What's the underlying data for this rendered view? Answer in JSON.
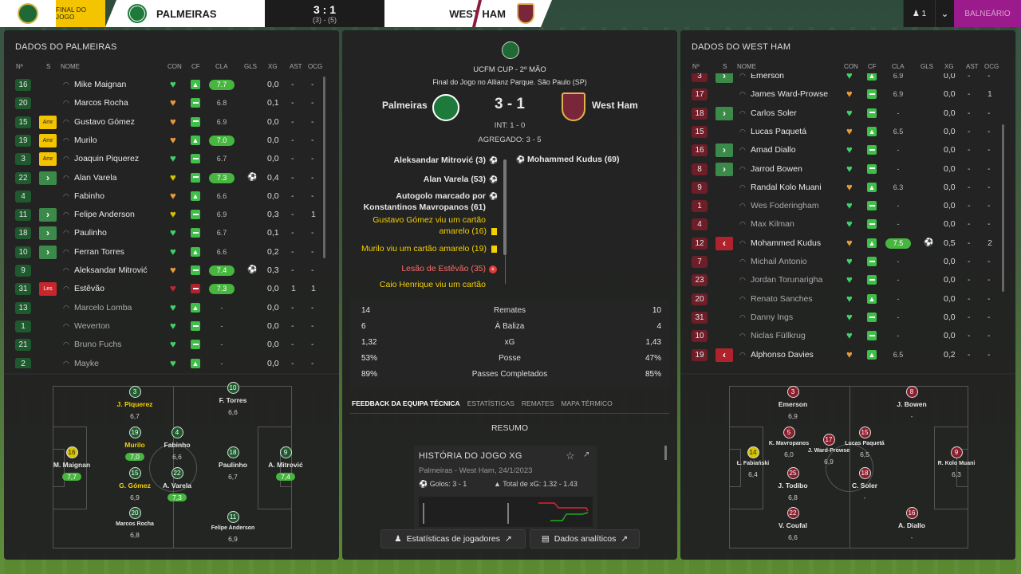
{
  "topbar": {
    "status": "FINAL DO JOGO",
    "home": "PALMEIRAS",
    "score": "3 : 1",
    "aggregate": "(3) - (5)",
    "away": "WEST HAM",
    "manager_count": "1",
    "balneario": "BALNEÁRIO"
  },
  "left": {
    "title": "DADOS DO PALMEIRAS",
    "headers": [
      "Nº",
      "S",
      "NOME",
      "CON",
      "CF",
      "CLA",
      "GLS",
      "XG",
      "AST",
      "OCG"
    ],
    "players": [
      {
        "n": "16",
        "s": "",
        "name": "Mike Maignan",
        "cla": "7.7",
        "xg": "0,0",
        "ast": "-",
        "ocg": "-",
        "hl": true
      },
      {
        "n": "20",
        "s": "",
        "name": "Marcos Rocha",
        "cla": "6.8",
        "xg": "0,1",
        "ast": "-",
        "ocg": "-"
      },
      {
        "n": "15",
        "s": "Amr",
        "name": "Gustavo Gómez",
        "cla": "6.9",
        "xg": "0,0",
        "ast": "-",
        "ocg": "-"
      },
      {
        "n": "19",
        "s": "Amr",
        "name": "Murilo",
        "cla": "7.0",
        "xg": "0,0",
        "ast": "-",
        "ocg": "-",
        "hl": true
      },
      {
        "n": "3",
        "s": "Amr",
        "name": "Joaquin Piquerez",
        "cla": "6.7",
        "xg": "0,0",
        "ast": "-",
        "ocg": "-"
      },
      {
        "n": "22",
        "s": "sub",
        "name": "Alan Varela",
        "cla": "7.3",
        "xg": "0,4",
        "ast": "-",
        "ocg": "-",
        "hl": true,
        "goal": true
      },
      {
        "n": "4",
        "s": "",
        "name": "Fabinho",
        "cla": "6.6",
        "xg": "0,0",
        "ast": "-",
        "ocg": "-"
      },
      {
        "n": "11",
        "s": "sub",
        "name": "Felipe Anderson",
        "cla": "6.9",
        "xg": "0,3",
        "ast": "-",
        "ocg": "1"
      },
      {
        "n": "18",
        "s": "sub",
        "name": "Paulinho",
        "cla": "6.7",
        "xg": "0,1",
        "ast": "-",
        "ocg": "-"
      },
      {
        "n": "10",
        "s": "sub",
        "name": "Ferran Torres",
        "cla": "6.6",
        "xg": "0,2",
        "ast": "-",
        "ocg": "-"
      },
      {
        "n": "9",
        "s": "",
        "name": "Aleksandar Mitrović",
        "cla": "7.4",
        "xg": "0,3",
        "ast": "-",
        "ocg": "-",
        "hl": true,
        "goal": true
      },
      {
        "n": "31",
        "s": "Les",
        "name": "Estêvão",
        "cla": "7.3",
        "xg": "0,0",
        "ast": "1",
        "ocg": "1",
        "hl": true,
        "red": true
      },
      {
        "n": "13",
        "s": "",
        "name": "Marcelo Lomba",
        "cla": "-",
        "xg": "0,0",
        "ast": "-",
        "ocg": "-",
        "dim": true
      },
      {
        "n": "1",
        "s": "",
        "name": "Weverton",
        "cla": "-",
        "xg": "0,0",
        "ast": "-",
        "ocg": "-",
        "dim": true
      },
      {
        "n": "21",
        "s": "",
        "name": "Bruno Fuchs",
        "cla": "-",
        "xg": "0,0",
        "ast": "-",
        "ocg": "-",
        "dim": true
      },
      {
        "n": "2",
        "s": "",
        "name": "Mayke",
        "cla": "-",
        "xg": "0,0",
        "ast": "-",
        "ocg": "-",
        "dim": true
      }
    ],
    "pitch": [
      {
        "n": "3",
        "name": "J. Piquerez",
        "r": "6,7",
        "yel": true
      },
      {
        "n": "10",
        "name": "F. Torres",
        "r": "6,6"
      },
      {
        "n": "19",
        "name": "Murilo",
        "r": "7,0",
        "yel": true,
        "hl": true
      },
      {
        "n": "4",
        "name": "Fabinho",
        "r": "6,6"
      },
      {
        "n": "16",
        "name": "M. Maignan",
        "r": "7,7",
        "hl": true,
        "ybg": true
      },
      {
        "n": "18",
        "name": "Paulinho",
        "r": "6,7"
      },
      {
        "n": "9",
        "name": "A. Mitrović",
        "r": "7,4",
        "hl": true
      },
      {
        "n": "15",
        "name": "G. Gómez",
        "r": "6,9",
        "yel": true
      },
      {
        "n": "22",
        "name": "A. Varela",
        "r": "7,3",
        "hl": true
      },
      {
        "n": "20",
        "name": "Marcos Rocha",
        "r": "6,8",
        "small": true
      },
      {
        "n": "11",
        "name": "Felipe Anderson",
        "r": "6,9",
        "small": true
      }
    ]
  },
  "mid": {
    "competition": "UCFM CUP - 2º MÃO",
    "venue": "Final do Jogo no Allianz Parque. São Paulo (SP)",
    "home": "Palmeiras",
    "away": "West Ham",
    "score": "3 - 1",
    "int": "INT: 1 - 0",
    "agg": "AGREGADO: 3 - 5",
    "events_home": [
      "Aleksandar Mitrović (3)",
      "Alan Varela (53)",
      "Autogolo marcado por",
      "Konstantinos Mavropanos (61)",
      "Gustavo Gómez viu um cartão",
      "amarelo (16)",
      "Murilo viu um cartão amarelo (19)",
      "Lesão de Estêvão (35)",
      "Caio Henrique viu um cartão"
    ],
    "events_away": [
      "Mohammed Kudus (69)"
    ],
    "stats": [
      {
        "h": "14",
        "l": "Remates",
        "a": "10"
      },
      {
        "h": "6",
        "l": "À Baliza",
        "a": "4"
      },
      {
        "h": "1,32",
        "l": "xG",
        "a": "1,43"
      },
      {
        "h": "53%",
        "l": "Posse",
        "a": "47%"
      },
      {
        "h": "89%",
        "l": "Passes Completados",
        "a": "85%"
      }
    ],
    "tabs": [
      "FEEDBACK DA EQUIPA TÉCNICA",
      "ESTATÍSTICAS",
      "REMATES",
      "MAPA TÉRMICO"
    ],
    "resumo": "RESUMO",
    "hist": {
      "title": "HISTÓRIA DO JOGO XG",
      "sub": "Palmeiras - West Ham, 24/1/2023",
      "goals": "Golos: 3 - 1",
      "xg": "Total de xG: 1.32 - 1.43"
    },
    "btn1": "Estatísticas de jogadores",
    "btn2": "Dados analíticos"
  },
  "right": {
    "title": "DADOS DO WEST HAM",
    "headers": [
      "Nº",
      "S",
      "NOME",
      "CON",
      "CF",
      "CLA",
      "GLS",
      "XG",
      "AST",
      "OCG"
    ],
    "players": [
      {
        "n": "3",
        "s": "sub",
        "name": "Emerson",
        "cla": "6.9",
        "xg": "0,0",
        "ast": "-",
        "ocg": "-"
      },
      {
        "n": "17",
        "s": "",
        "name": "James Ward-Prowse",
        "cla": "6.9",
        "xg": "0,0",
        "ast": "-",
        "ocg": "1"
      },
      {
        "n": "18",
        "s": "sub",
        "name": "Carlos Soler",
        "cla": "-",
        "xg": "0,0",
        "ast": "-",
        "ocg": "-"
      },
      {
        "n": "15",
        "s": "",
        "name": "Lucas Paquetá",
        "cla": "6.5",
        "xg": "0,0",
        "ast": "-",
        "ocg": "-"
      },
      {
        "n": "16",
        "s": "sub",
        "name": "Amad Diallo",
        "cla": "-",
        "xg": "0,0",
        "ast": "-",
        "ocg": "-"
      },
      {
        "n": "8",
        "s": "sub",
        "name": "Jarrod Bowen",
        "cla": "-",
        "xg": "0,0",
        "ast": "-",
        "ocg": "-"
      },
      {
        "n": "9",
        "s": "",
        "name": "Randal Kolo Muani",
        "cla": "6.3",
        "xg": "0,0",
        "ast": "-",
        "ocg": "-"
      },
      {
        "n": "1",
        "s": "",
        "name": "Wes Foderingham",
        "cla": "-",
        "xg": "0,0",
        "ast": "-",
        "ocg": "-",
        "dim": true
      },
      {
        "n": "4",
        "s": "",
        "name": "Max Kilman",
        "cla": "-",
        "xg": "0,0",
        "ast": "-",
        "ocg": "-",
        "dim": true
      },
      {
        "n": "12",
        "s": "subout",
        "name": "Mohammed Kudus",
        "cla": "7.5",
        "xg": "0,5",
        "ast": "-",
        "ocg": "2",
        "hl": true,
        "goal": true
      },
      {
        "n": "7",
        "s": "",
        "name": "Michail Antonio",
        "cla": "-",
        "xg": "0,0",
        "ast": "-",
        "ocg": "-",
        "dim": true
      },
      {
        "n": "23",
        "s": "",
        "name": "Jordan Torunarigha",
        "cla": "-",
        "xg": "0,0",
        "ast": "-",
        "ocg": "-",
        "dim": true
      },
      {
        "n": "20",
        "s": "",
        "name": "Renato Sanches",
        "cla": "-",
        "xg": "0,0",
        "ast": "-",
        "ocg": "-",
        "dim": true
      },
      {
        "n": "31",
        "s": "",
        "name": "Danny Ings",
        "cla": "-",
        "xg": "0,0",
        "ast": "-",
        "ocg": "-",
        "dim": true
      },
      {
        "n": "10",
        "s": "",
        "name": "Niclas Füllkrug",
        "cla": "-",
        "xg": "0,0",
        "ast": "-",
        "ocg": "-",
        "dim": true
      },
      {
        "n": "19",
        "s": "subout",
        "name": "Alphonso Davies",
        "cla": "6.5",
        "xg": "0,2",
        "ast": "-",
        "ocg": "-"
      }
    ],
    "pitch": [
      {
        "n": "3",
        "name": "Emerson",
        "r": "6,9"
      },
      {
        "n": "8",
        "name": "J. Bowen",
        "r": "-"
      },
      {
        "n": "5",
        "name": "K. Mavropanos",
        "r": "6,0",
        "small": true
      },
      {
        "n": "17",
        "name": "J. Ward-Prowse",
        "r": "6,9",
        "small": true
      },
      {
        "n": "15",
        "name": "Lucas Paquetá",
        "r": "6,5",
        "small": true
      },
      {
        "n": "14",
        "name": "Ł. Fabiański",
        "r": "6,4",
        "small": true,
        "ybg": true
      },
      {
        "n": "9",
        "name": "R. Kolo Muani",
        "r": "6,3",
        "small": true
      },
      {
        "n": "25",
        "name": "J. Todibo",
        "r": "6,8"
      },
      {
        "n": "18",
        "name": "C. Soler",
        "r": "-"
      },
      {
        "n": "22",
        "name": "V. Coufal",
        "r": "6,6"
      },
      {
        "n": "16",
        "name": "A. Diallo",
        "r": "-"
      }
    ]
  }
}
